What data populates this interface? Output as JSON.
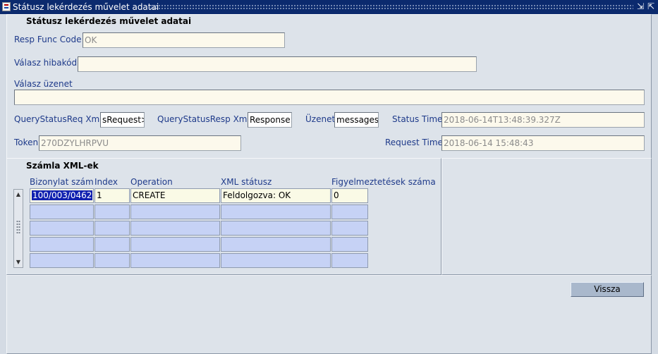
{
  "window": {
    "title": "Státusz lekérdezés művelet adatai",
    "minimize_glyph": "⇲",
    "maximize_glyph": "⇱"
  },
  "header": {
    "section_title": "Státusz lekérdezés művelet adatai"
  },
  "fields": {
    "resp_func_code": {
      "label": "Resp Func Code",
      "value": "OK"
    },
    "valasz_hibakod": {
      "label": "Válasz hibakód",
      "value": ""
    },
    "valasz_uzenet": {
      "label": "Válasz üzenet",
      "value": ""
    },
    "query_status_req_xml": {
      "label": "QueryStatusReq Xml",
      "value": "sRequest>"
    },
    "query_status_resp_xml": {
      "label": "QueryStatusResp Xml",
      "value": "Response>"
    },
    "uzenet": {
      "label": "Üzenet",
      "value": "messages>"
    },
    "status_time": {
      "label": "Status Time",
      "value": "2018-06-14T13:48:39.327Z"
    },
    "token": {
      "label": "Token",
      "value": "270DZYLHRPVU"
    },
    "request_time": {
      "label": "Request Time",
      "value": "2018-06-14 15:48:43"
    }
  },
  "grid": {
    "title": "Számla XML-ek",
    "columns": [
      "Bizonylat szám",
      "Index",
      "Operation",
      "XML státusz",
      "Figyelmeztetések száma"
    ],
    "rows": [
      [
        "100/003/0462",
        "1",
        "CREATE",
        "Feldolgozva: OK",
        "0"
      ],
      [
        "",
        "",
        "",
        "",
        ""
      ],
      [
        "",
        "",
        "",
        "",
        ""
      ],
      [
        "",
        "",
        "",
        "",
        ""
      ],
      [
        "",
        "",
        "",
        "",
        ""
      ]
    ]
  },
  "buttons": {
    "vissza": "Vissza"
  }
}
